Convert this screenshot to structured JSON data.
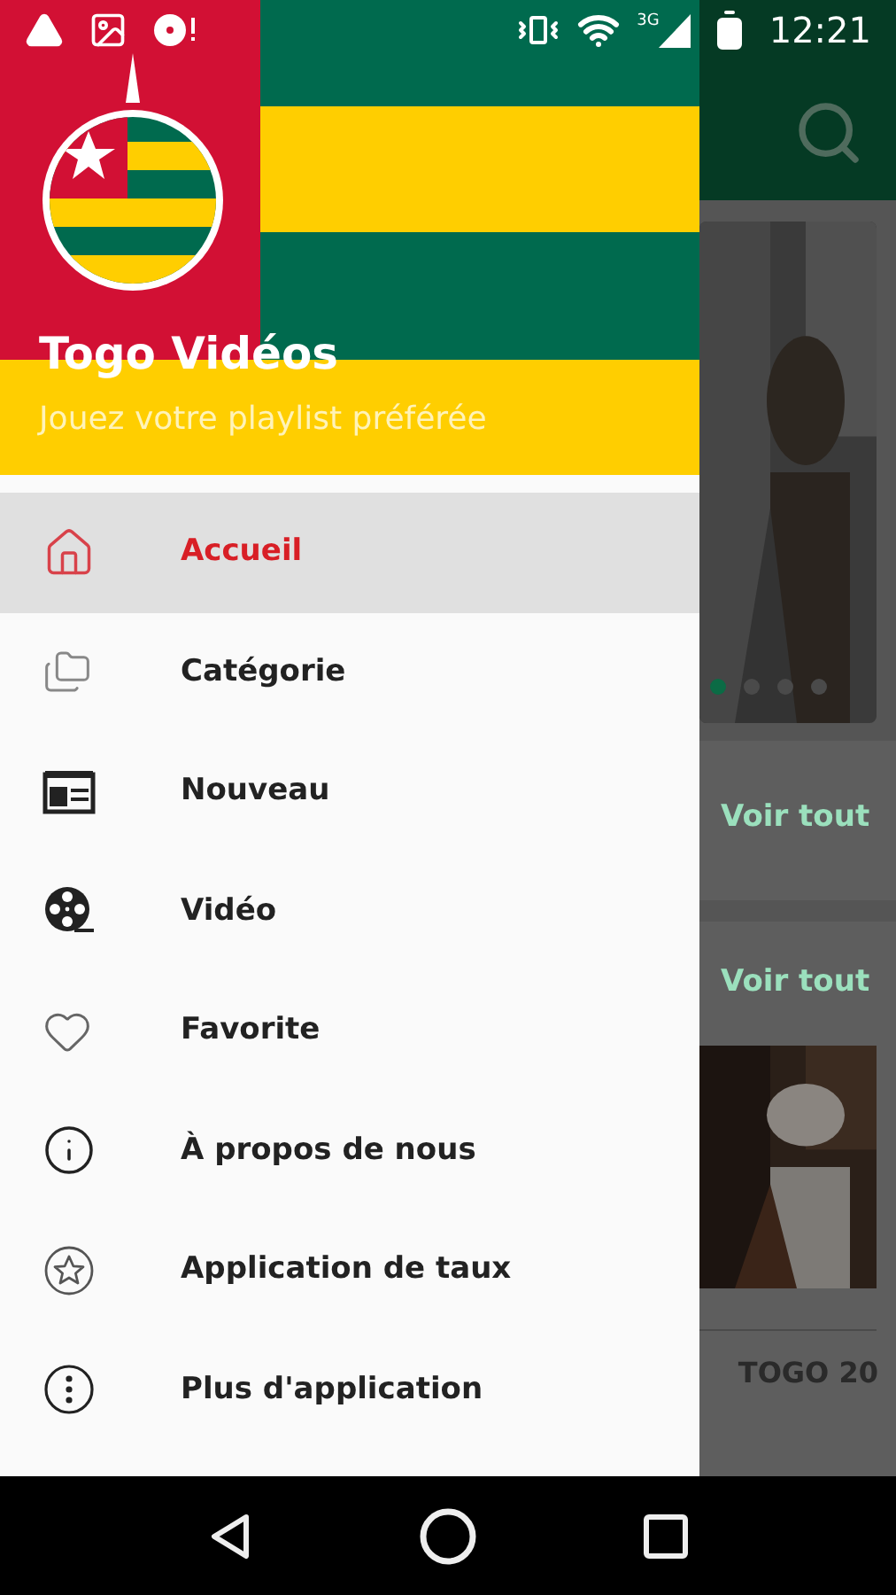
{
  "status_bar": {
    "network": "3G",
    "time": "12:21"
  },
  "drawer": {
    "title": "Togo Vidéos",
    "subtitle": "Jouez votre playlist préférée",
    "items": [
      {
        "label": "Accueil",
        "kind": "home",
        "selected": true
      },
      {
        "label": "Catégorie",
        "kind": "folders",
        "selected": false
      },
      {
        "label": "Nouveau",
        "kind": "news",
        "selected": false
      },
      {
        "label": "Vidéo",
        "kind": "reel",
        "selected": false
      },
      {
        "label": "Favorite",
        "kind": "heart",
        "selected": false
      },
      {
        "label": "À propos de nous",
        "kind": "info",
        "selected": false
      },
      {
        "label": "Application de taux",
        "kind": "star",
        "selected": false
      },
      {
        "label": "Plus d'application",
        "kind": "more",
        "selected": false
      }
    ]
  },
  "background": {
    "carousel_dots": [
      {
        "selected": true
      },
      {
        "selected": false
      },
      {
        "selected": false
      },
      {
        "selected": false
      }
    ],
    "links": [
      "Voir tout",
      "Voir tout"
    ],
    "caption": "TOGO 20"
  }
}
